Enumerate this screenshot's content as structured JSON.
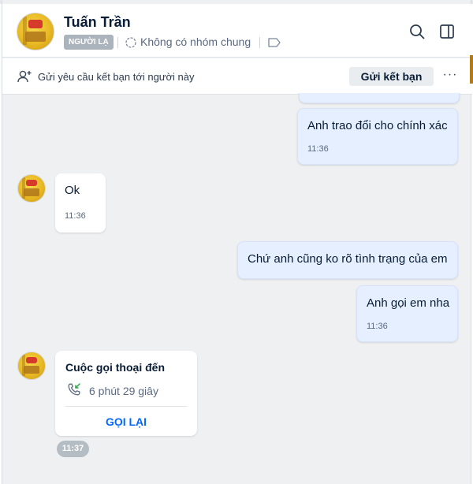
{
  "header": {
    "name": "Tuấn Trần",
    "badge": "NGƯỜI LẠ",
    "group_text": "Không có nhóm chung",
    "icons": [
      "group-icon",
      "tag-icon",
      "search-icon",
      "side-panel-icon"
    ]
  },
  "friend_bar": {
    "text": "Gửi yêu cầu kết bạn tới người này",
    "button_label": "Gửi kết bạn",
    "more_label": "···"
  },
  "messages": [
    {
      "side": "mine",
      "text": "Anh trao đổi cho chính xác",
      "time": "11:36"
    },
    {
      "side": "theirs",
      "text": "Ok",
      "time": "11:36"
    },
    {
      "side": "mine",
      "text": "Chứ anh cũng ko rõ tình trạng của em",
      "time": ""
    },
    {
      "side": "mine",
      "text": "Anh gọi em nha",
      "time": "11:36"
    }
  ],
  "call": {
    "title": "Cuộc gọi thoại đến",
    "duration": "6 phút 29 giây",
    "callback_label": "GỌI LẠI",
    "time": "11:37"
  },
  "colors": {
    "accent": "#0068ff",
    "my_bubble": "#e5efff",
    "background": "#eef0f1",
    "call_green": "#2ea64a"
  }
}
